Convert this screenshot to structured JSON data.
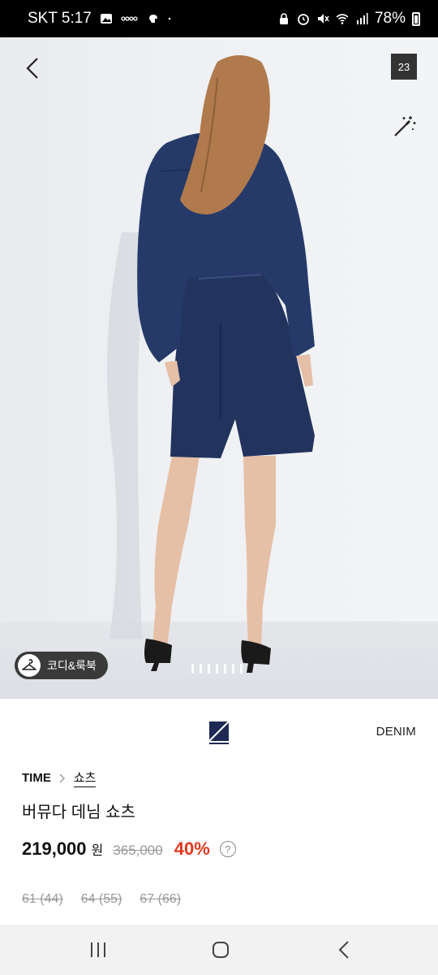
{
  "status": {
    "carrier_time": "SKT 5:17",
    "battery": "78%"
  },
  "gallery": {
    "image_count": "23",
    "lookbook_label": "코디&룩북",
    "page_indicators": 7
  },
  "product": {
    "brand_tag": "DENIM",
    "brand": "TIME",
    "category": "쇼츠",
    "title": "버뮤다 데님 쇼츠",
    "price": "219,000",
    "currency": "원",
    "original_price": "365,000",
    "discount": "40%",
    "help": "?",
    "sizes": [
      "61 (44)",
      "64 (55)",
      "67 (66)"
    ]
  },
  "icons": {
    "back": "chevron-left-icon",
    "magic": "magic-wand-icon",
    "lookbook": "hanger-icon",
    "nav_recent": "recent-apps-icon",
    "nav_home": "home-icon",
    "nav_back": "back-icon"
  }
}
